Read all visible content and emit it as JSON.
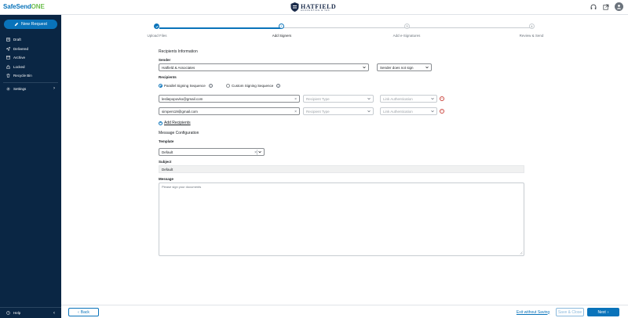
{
  "app": {
    "brand_main": "SafeSend",
    "brand_suffix": "ONE",
    "firm_name": "HATFIELD",
    "firm_tagline": "ACCOUNTING & TAX"
  },
  "sidebar": {
    "new_request": "New Request",
    "items": [
      {
        "label": "Draft",
        "icon": "draft-icon"
      },
      {
        "label": "Delivered",
        "icon": "send-icon"
      },
      {
        "label": "Archive",
        "icon": "archive-icon"
      },
      {
        "label": "Locked",
        "icon": "lock-icon"
      },
      {
        "label": "Recycle Bin",
        "icon": "trash-icon"
      }
    ],
    "settings": "Settings",
    "help": "Help"
  },
  "stepper": {
    "steps": [
      {
        "label": "Upload Files",
        "number": "",
        "state": "done"
      },
      {
        "label": "Add Signers",
        "number": "2",
        "state": "active"
      },
      {
        "label": "Add e-Signatures",
        "number": "3",
        "state": "todo"
      },
      {
        "label": "Review & Send",
        "number": "4",
        "state": "todo"
      }
    ]
  },
  "recipients_info": {
    "title": "Recipients Information",
    "sender_label": "Sender",
    "sender_value": "Hatfield & Associates",
    "sender_sign_value": "Sender does not sign",
    "recipients_label": "Recipients",
    "parallel_label": "Parallel Signing Sequence",
    "custom_label": "Custom Signing Sequence",
    "rows": [
      {
        "email": "lesliepopovko@gmail.com",
        "type_placeholder": "Recipient Type",
        "auth_placeholder": "Link Authentication"
      },
      {
        "email": "simpers19@gmail.com",
        "type_placeholder": "Recipient Type",
        "auth_placeholder": "Link Authentication"
      }
    ],
    "add_recipients": "Add Recipients"
  },
  "message_config": {
    "title": "Message Configuration",
    "template_label": "Template",
    "template_value": "Default",
    "subject_label": "Subject",
    "subject_value": "Default",
    "message_label": "Message",
    "message_value": "Please sign your documents"
  },
  "footer": {
    "back": "Back",
    "exit": "Exit without Saving",
    "save_close": "Save & Close",
    "next": "Next"
  },
  "colors": {
    "primary": "#0973ba",
    "sidebar": "#0a2644",
    "danger": "#cc4a43",
    "brand_accent": "#6ebf4f"
  }
}
